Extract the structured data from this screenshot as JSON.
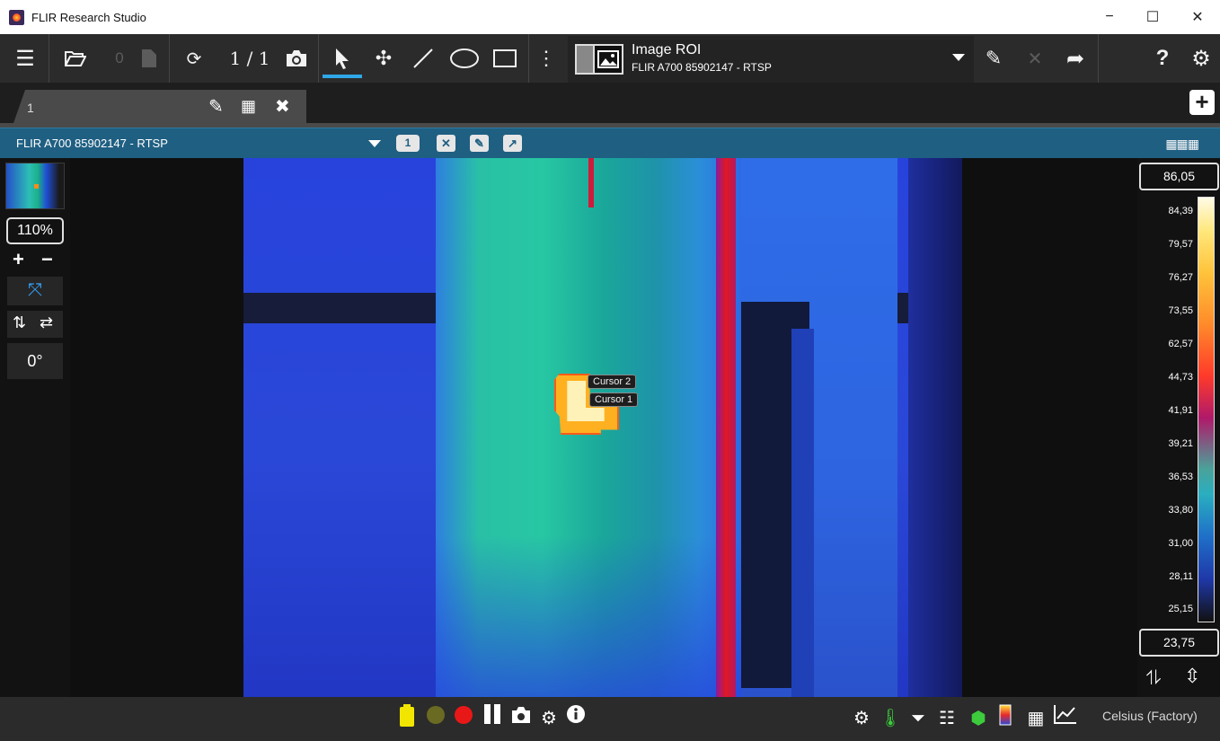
{
  "window": {
    "title": "FLIR Research Studio",
    "minimize": "−",
    "maximize": "☐",
    "close": "✕"
  },
  "toolbar": {
    "record_count": "0",
    "frame_counter": "1 / 1",
    "roi_title": "Image ROI",
    "roi_source": "FLIR A700 85902147 - RTSP",
    "icons": [
      "menu-icon",
      "folder-open-icon",
      "file-icon",
      "refresh-icon",
      "camera-icon",
      "arrow-pointer-icon",
      "crosshair-icon",
      "line-tool-icon",
      "ellipse-tool-icon",
      "rectangle-tool-icon",
      "more-vertical-icon",
      "pencil-icon",
      "delete-icon",
      "share-icon",
      "help-icon",
      "gear-icon"
    ]
  },
  "tabs": [
    {
      "label": "1"
    }
  ],
  "viewer": {
    "source": "FLIR A700 85902147 - RTSP",
    "badge": "1"
  },
  "left_panel": {
    "zoom": "110%",
    "rotation": "0°"
  },
  "image": {
    "cursor_2": "Cursor 2",
    "cursor_1": "Cursor 1"
  },
  "palette": {
    "max": "86,05",
    "min": "23,75",
    "ticks": [
      "84,39",
      "79,57",
      "76,27",
      "73,55",
      "62,57",
      "44,73",
      "41,91",
      "39,21",
      "36,53",
      "33,80",
      "31,00",
      "28,11",
      "25,15"
    ]
  },
  "status": {
    "unit": "Celsius (Factory)"
  },
  "colors": {
    "accent": "#2fa7e8",
    "header_blue": "#1f5f82",
    "record_red": "#e81818",
    "battery_yellow": "#f2e600"
  }
}
